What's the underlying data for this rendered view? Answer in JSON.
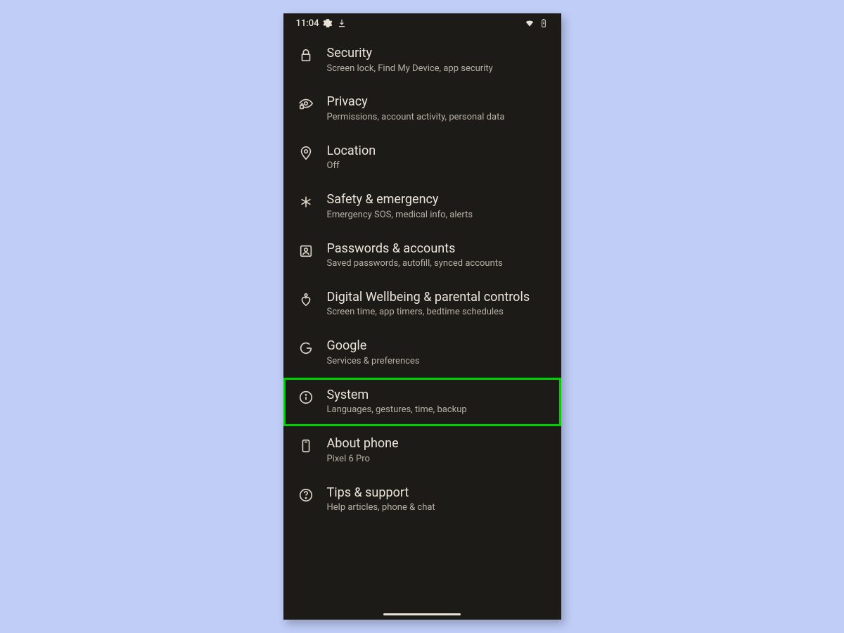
{
  "status": {
    "time": "11:04"
  },
  "settings": [
    {
      "id": "security",
      "title": "Security",
      "subtitle": "Screen lock, Find My Device, app security",
      "icon": "lock-icon",
      "highlighted": false
    },
    {
      "id": "privacy",
      "title": "Privacy",
      "subtitle": "Permissions, account activity, personal data",
      "icon": "eye-lock-icon",
      "highlighted": false
    },
    {
      "id": "location",
      "title": "Location",
      "subtitle": "Off",
      "icon": "location-pin-icon",
      "highlighted": false
    },
    {
      "id": "safety",
      "title": "Safety & emergency",
      "subtitle": "Emergency SOS, medical info, alerts",
      "icon": "asterisk-icon",
      "highlighted": false
    },
    {
      "id": "passwords",
      "title": "Passwords & accounts",
      "subtitle": "Saved passwords, autofill, synced accounts",
      "icon": "account-box-icon",
      "highlighted": false
    },
    {
      "id": "wellbeing",
      "title": "Digital Wellbeing & parental controls",
      "subtitle": "Screen time, app timers, bedtime schedules",
      "icon": "heart-person-icon",
      "highlighted": false
    },
    {
      "id": "google",
      "title": "Google",
      "subtitle": "Services & preferences",
      "icon": "google-g-icon",
      "highlighted": false
    },
    {
      "id": "system",
      "title": "System",
      "subtitle": "Languages, gestures, time, backup",
      "icon": "info-icon",
      "highlighted": true
    },
    {
      "id": "about",
      "title": "About phone",
      "subtitle": "Pixel 6 Pro",
      "icon": "phone-device-icon",
      "highlighted": false
    },
    {
      "id": "tips",
      "title": "Tips & support",
      "subtitle": "Help articles, phone & chat",
      "icon": "help-icon",
      "highlighted": false
    }
  ]
}
